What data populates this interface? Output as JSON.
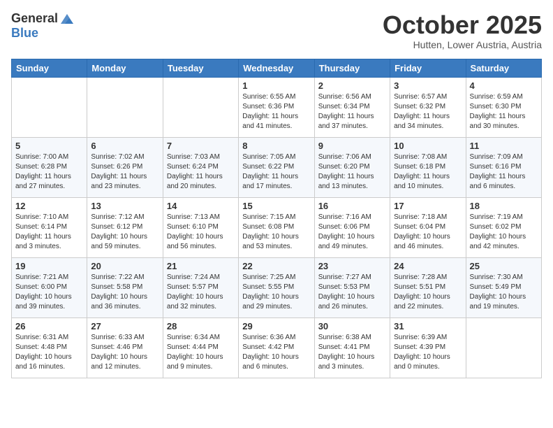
{
  "header": {
    "logo_general": "General",
    "logo_blue": "Blue",
    "month_title": "October 2025",
    "location": "Hutten, Lower Austria, Austria"
  },
  "days_of_week": [
    "Sunday",
    "Monday",
    "Tuesday",
    "Wednesday",
    "Thursday",
    "Friday",
    "Saturday"
  ],
  "weeks": [
    [
      {
        "day": "",
        "info": ""
      },
      {
        "day": "",
        "info": ""
      },
      {
        "day": "",
        "info": ""
      },
      {
        "day": "1",
        "info": "Sunrise: 6:55 AM\nSunset: 6:36 PM\nDaylight: 11 hours\nand 41 minutes."
      },
      {
        "day": "2",
        "info": "Sunrise: 6:56 AM\nSunset: 6:34 PM\nDaylight: 11 hours\nand 37 minutes."
      },
      {
        "day": "3",
        "info": "Sunrise: 6:57 AM\nSunset: 6:32 PM\nDaylight: 11 hours\nand 34 minutes."
      },
      {
        "day": "4",
        "info": "Sunrise: 6:59 AM\nSunset: 6:30 PM\nDaylight: 11 hours\nand 30 minutes."
      }
    ],
    [
      {
        "day": "5",
        "info": "Sunrise: 7:00 AM\nSunset: 6:28 PM\nDaylight: 11 hours\nand 27 minutes."
      },
      {
        "day": "6",
        "info": "Sunrise: 7:02 AM\nSunset: 6:26 PM\nDaylight: 11 hours\nand 23 minutes."
      },
      {
        "day": "7",
        "info": "Sunrise: 7:03 AM\nSunset: 6:24 PM\nDaylight: 11 hours\nand 20 minutes."
      },
      {
        "day": "8",
        "info": "Sunrise: 7:05 AM\nSunset: 6:22 PM\nDaylight: 11 hours\nand 17 minutes."
      },
      {
        "day": "9",
        "info": "Sunrise: 7:06 AM\nSunset: 6:20 PM\nDaylight: 11 hours\nand 13 minutes."
      },
      {
        "day": "10",
        "info": "Sunrise: 7:08 AM\nSunset: 6:18 PM\nDaylight: 11 hours\nand 10 minutes."
      },
      {
        "day": "11",
        "info": "Sunrise: 7:09 AM\nSunset: 6:16 PM\nDaylight: 11 hours\nand 6 minutes."
      }
    ],
    [
      {
        "day": "12",
        "info": "Sunrise: 7:10 AM\nSunset: 6:14 PM\nDaylight: 11 hours\nand 3 minutes."
      },
      {
        "day": "13",
        "info": "Sunrise: 7:12 AM\nSunset: 6:12 PM\nDaylight: 10 hours\nand 59 minutes."
      },
      {
        "day": "14",
        "info": "Sunrise: 7:13 AM\nSunset: 6:10 PM\nDaylight: 10 hours\nand 56 minutes."
      },
      {
        "day": "15",
        "info": "Sunrise: 7:15 AM\nSunset: 6:08 PM\nDaylight: 10 hours\nand 53 minutes."
      },
      {
        "day": "16",
        "info": "Sunrise: 7:16 AM\nSunset: 6:06 PM\nDaylight: 10 hours\nand 49 minutes."
      },
      {
        "day": "17",
        "info": "Sunrise: 7:18 AM\nSunset: 6:04 PM\nDaylight: 10 hours\nand 46 minutes."
      },
      {
        "day": "18",
        "info": "Sunrise: 7:19 AM\nSunset: 6:02 PM\nDaylight: 10 hours\nand 42 minutes."
      }
    ],
    [
      {
        "day": "19",
        "info": "Sunrise: 7:21 AM\nSunset: 6:00 PM\nDaylight: 10 hours\nand 39 minutes."
      },
      {
        "day": "20",
        "info": "Sunrise: 7:22 AM\nSunset: 5:58 PM\nDaylight: 10 hours\nand 36 minutes."
      },
      {
        "day": "21",
        "info": "Sunrise: 7:24 AM\nSunset: 5:57 PM\nDaylight: 10 hours\nand 32 minutes."
      },
      {
        "day": "22",
        "info": "Sunrise: 7:25 AM\nSunset: 5:55 PM\nDaylight: 10 hours\nand 29 minutes."
      },
      {
        "day": "23",
        "info": "Sunrise: 7:27 AM\nSunset: 5:53 PM\nDaylight: 10 hours\nand 26 minutes."
      },
      {
        "day": "24",
        "info": "Sunrise: 7:28 AM\nSunset: 5:51 PM\nDaylight: 10 hours\nand 22 minutes."
      },
      {
        "day": "25",
        "info": "Sunrise: 7:30 AM\nSunset: 5:49 PM\nDaylight: 10 hours\nand 19 minutes."
      }
    ],
    [
      {
        "day": "26",
        "info": "Sunrise: 6:31 AM\nSunset: 4:48 PM\nDaylight: 10 hours\nand 16 minutes."
      },
      {
        "day": "27",
        "info": "Sunrise: 6:33 AM\nSunset: 4:46 PM\nDaylight: 10 hours\nand 12 minutes."
      },
      {
        "day": "28",
        "info": "Sunrise: 6:34 AM\nSunset: 4:44 PM\nDaylight: 10 hours\nand 9 minutes."
      },
      {
        "day": "29",
        "info": "Sunrise: 6:36 AM\nSunset: 4:42 PM\nDaylight: 10 hours\nand 6 minutes."
      },
      {
        "day": "30",
        "info": "Sunrise: 6:38 AM\nSunset: 4:41 PM\nDaylight: 10 hours\nand 3 minutes."
      },
      {
        "day": "31",
        "info": "Sunrise: 6:39 AM\nSunset: 4:39 PM\nDaylight: 10 hours\nand 0 minutes."
      },
      {
        "day": "",
        "info": ""
      }
    ]
  ]
}
